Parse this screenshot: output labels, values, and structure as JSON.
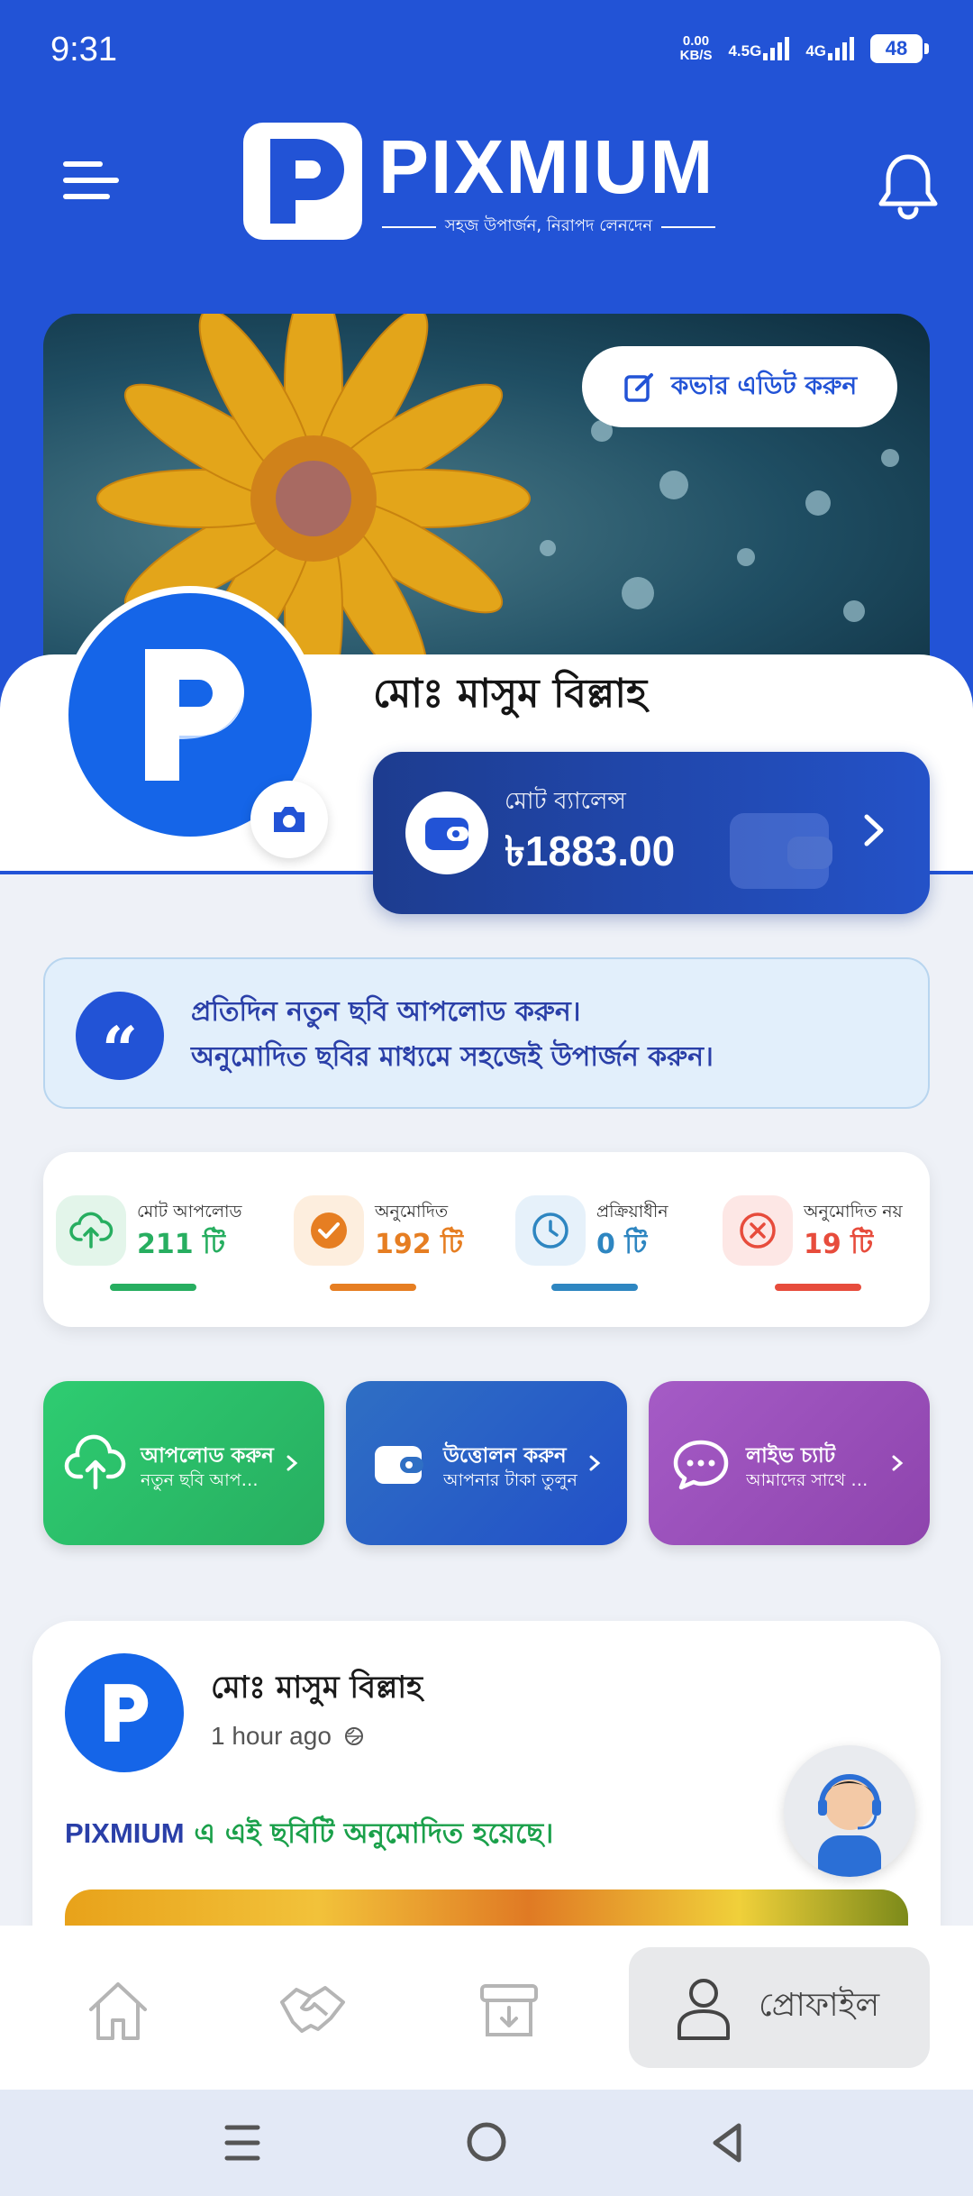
{
  "status_bar": {
    "time": "9:31",
    "net_speed_value": "0.00",
    "net_speed_unit": "KB/S",
    "net1": "4.5G",
    "net2": "4G",
    "battery": "48"
  },
  "header": {
    "brand": "PIXMIUM",
    "tagline": "সহজ উপার্জন, নিরাপদ লেনদেন"
  },
  "profile": {
    "cover_edit_label": "কভার এডিট করুন",
    "name": "মোঃ মাসুম বিল্লাহ",
    "balance_label": "মোট ব্যালেন্স",
    "balance_value": "৳1883.00"
  },
  "quote": {
    "line1": "প্রতিদিন নতুন ছবি আপলোড করুন।",
    "line2": "অনুমোদিত ছবির মাধ্যমে সহজেই উপার্জন করুন।"
  },
  "stats": [
    {
      "label": "মোট আপলোড",
      "value": "211 টি",
      "color": "#27ae60"
    },
    {
      "label": "অনুমোদিত",
      "value": "192 টি",
      "color": "#e67e22"
    },
    {
      "label": "প্রক্রিয়াধীন",
      "value": "0 টি",
      "color": "#2e86c1"
    },
    {
      "label": "অনুমোদিত নয়",
      "value": "19 টি",
      "color": "#e74c3c"
    }
  ],
  "actions": [
    {
      "title": "আপলোড করুন",
      "subtitle": "নতুন ছবি আপলোড করুন"
    },
    {
      "title": "উত্তোলন করুন",
      "subtitle": "আপনার টাকা তুলুন"
    },
    {
      "title": "লাইভ চ্যাট",
      "subtitle": "আমাদের সাথে কথা বলুন"
    }
  ],
  "post": {
    "author": "মোঃ মাসুম বিল্লাহ",
    "time": "1 hour ago",
    "brand": "PIXMIUM",
    "text": " এ এই ছবিটি অনুমোদিত হয়েছে।"
  },
  "bottom_nav": {
    "profile_label": "প্রোফাইল"
  },
  "colors": {
    "primary": "#2253d6",
    "success": "#27ae60",
    "warning": "#e67e22",
    "info": "#2e86c1",
    "danger": "#e74c3c"
  }
}
